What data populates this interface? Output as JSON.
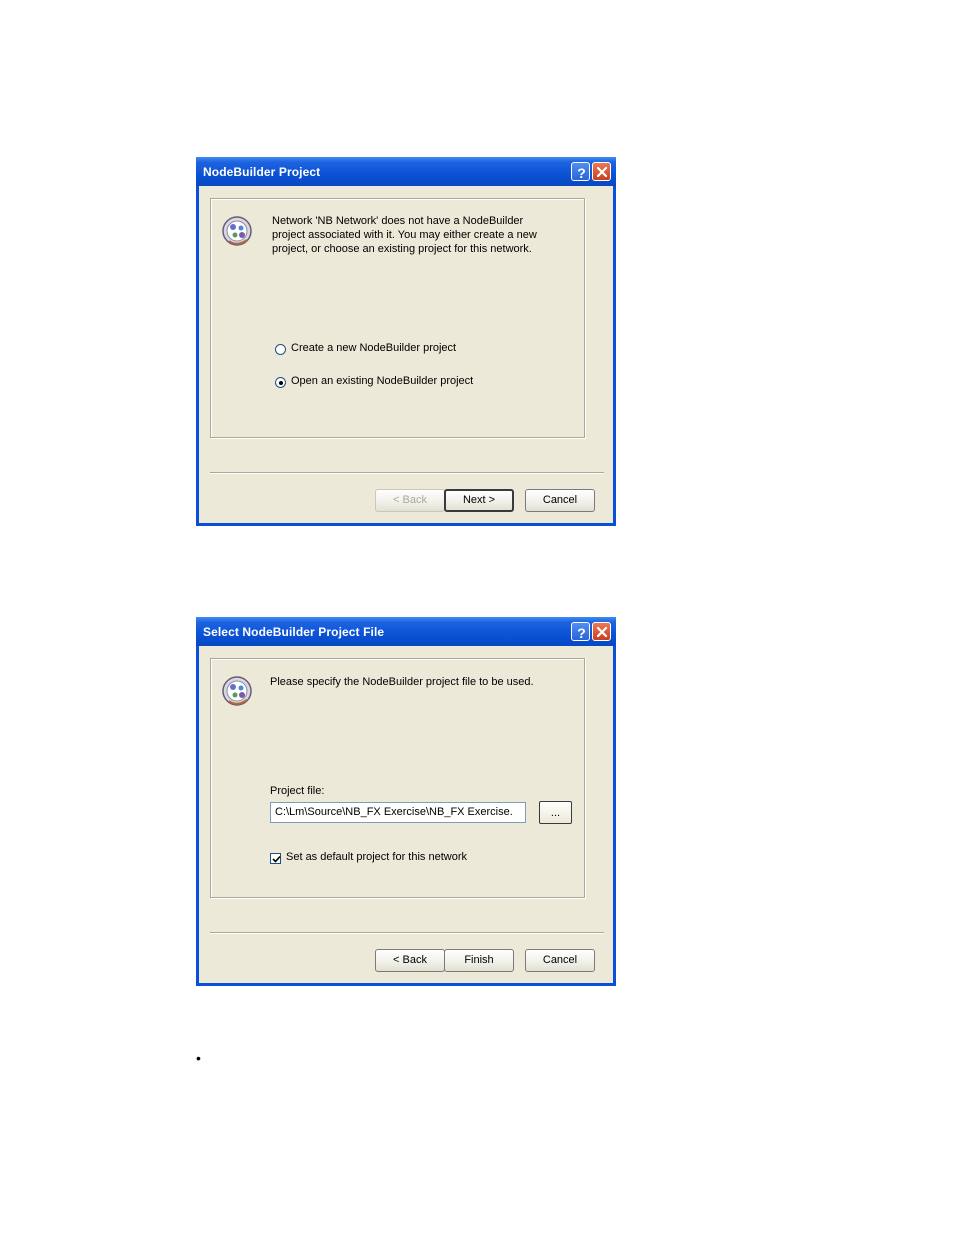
{
  "dialog1": {
    "title": "NodeBuilder Project",
    "message_lines": [
      "Network 'NB Network' does not have a NodeBuilder",
      "project associated with it. You may either create a new",
      "project, or choose an existing project for this network."
    ],
    "options": [
      {
        "label": "Create a new NodeBuilder project",
        "checked": false
      },
      {
        "label": "Open an existing NodeBuilder project",
        "checked": true
      }
    ],
    "buttons": {
      "back": "< Back",
      "next": "Next >",
      "cancel": "Cancel"
    }
  },
  "dialog2": {
    "title": "Select NodeBuilder Project File",
    "message": "Please specify the NodeBuilder project file to be used.",
    "field_label": "Project file:",
    "field_value": "C:\\Lm\\Source\\NB_FX Exercise\\NB_FX Exercise.",
    "browse_label": "...",
    "checkbox_label": "Set as default project for this network",
    "checkbox_checked": true,
    "buttons": {
      "back": "< Back",
      "finish": "Finish",
      "cancel": "Cancel"
    }
  },
  "bullet": "•",
  "icons": {
    "help": "help-icon",
    "close": "close-icon",
    "wizard": "nodebuilder-wizard-icon"
  }
}
